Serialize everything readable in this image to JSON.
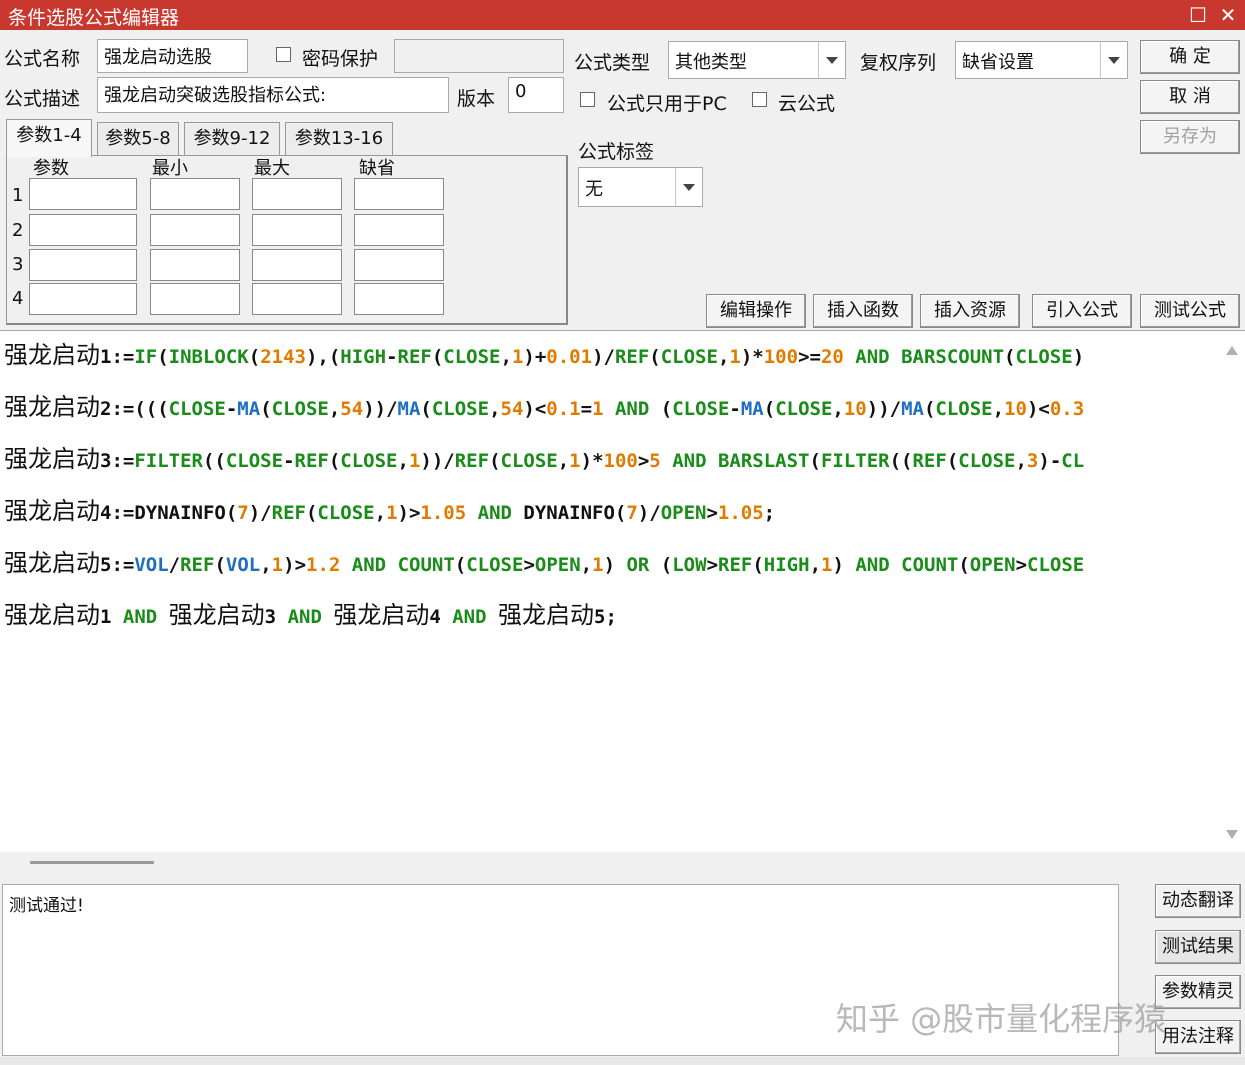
{
  "window": {
    "title": "条件选股公式编辑器"
  },
  "form": {
    "name_label": "公式名称",
    "name_value": "强龙启动选股",
    "password_label": "密码保护",
    "password_value": "",
    "desc_label": "公式描述",
    "desc_value": "强龙启动突破选股指标公式:",
    "version_label": "版本",
    "version_value": "0",
    "type_label": "公式类型",
    "type_value": "其他类型",
    "rights_label": "复权序列",
    "rights_value": "缺省设置",
    "pc_only_label": "公式只用于PC",
    "cloud_label": "云公式",
    "tag_label": "公式标签",
    "tag_value": "无"
  },
  "buttons": {
    "ok": "确  定",
    "cancel": "取  消",
    "save_as": "另存为",
    "edit_ops": "编辑操作",
    "insert_func": "插入函数",
    "insert_res": "插入资源",
    "import_formula": "引入公式",
    "test_formula": "测试公式"
  },
  "params": {
    "tabs": [
      "参数1-4",
      "参数5-8",
      "参数9-12",
      "参数13-16"
    ],
    "headers": [
      "参数",
      "最小",
      "最大",
      "缺省"
    ],
    "rows": [
      "1",
      "2",
      "3",
      "4"
    ]
  },
  "code_lines": [
    [
      [
        "cn",
        "强龙启动"
      ],
      [
        "b",
        "1:="
      ],
      [
        "g",
        "IF"
      ],
      [
        "b",
        "("
      ],
      [
        "g",
        "INBLOCK"
      ],
      [
        "b",
        "("
      ],
      [
        "o",
        "2143"
      ],
      [
        "b",
        "),("
      ],
      [
        "g",
        "HIGH"
      ],
      [
        "b",
        "-"
      ],
      [
        "g",
        "REF"
      ],
      [
        "b",
        "("
      ],
      [
        "g",
        "CLOSE"
      ],
      [
        "b",
        ","
      ],
      [
        "o",
        "1"
      ],
      [
        "b",
        ")+"
      ],
      [
        "o",
        "0.01"
      ],
      [
        "b",
        ")/"
      ],
      [
        "g",
        "REF"
      ],
      [
        "b",
        "("
      ],
      [
        "g",
        "CLOSE"
      ],
      [
        "b",
        ","
      ],
      [
        "o",
        "1"
      ],
      [
        "b",
        ")*"
      ],
      [
        "o",
        "100"
      ],
      [
        "b",
        ">="
      ],
      [
        "o",
        "20"
      ],
      [
        "b",
        " "
      ],
      [
        "g",
        "AND"
      ],
      [
        "b",
        " "
      ],
      [
        "g",
        "BARSCOUNT"
      ],
      [
        "b",
        "("
      ],
      [
        "g",
        "CLOSE"
      ],
      [
        "b",
        ")"
      ]
    ],
    [
      [
        "cn",
        "强龙启动"
      ],
      [
        "b",
        "2:=((("
      ],
      [
        "g",
        "CLOSE"
      ],
      [
        "b",
        "-"
      ],
      [
        "c",
        "MA"
      ],
      [
        "b",
        "("
      ],
      [
        "g",
        "CLOSE"
      ],
      [
        "b",
        ","
      ],
      [
        "o",
        "54"
      ],
      [
        "b",
        "))/"
      ],
      [
        "c",
        "MA"
      ],
      [
        "b",
        "("
      ],
      [
        "g",
        "CLOSE"
      ],
      [
        "b",
        ","
      ],
      [
        "o",
        "54"
      ],
      [
        "b",
        ")<"
      ],
      [
        "o",
        "0.1"
      ],
      [
        "b",
        "="
      ],
      [
        "o",
        "1"
      ],
      [
        "b",
        " "
      ],
      [
        "g",
        "AND"
      ],
      [
        "b",
        " ("
      ],
      [
        "g",
        "CLOSE"
      ],
      [
        "b",
        "-"
      ],
      [
        "c",
        "MA"
      ],
      [
        "b",
        "("
      ],
      [
        "g",
        "CLOSE"
      ],
      [
        "b",
        ","
      ],
      [
        "o",
        "10"
      ],
      [
        "b",
        "))/"
      ],
      [
        "c",
        "MA"
      ],
      [
        "b",
        "("
      ],
      [
        "g",
        "CLOSE"
      ],
      [
        "b",
        ","
      ],
      [
        "o",
        "10"
      ],
      [
        "b",
        ")<"
      ],
      [
        "o",
        "0.3"
      ]
    ],
    [
      [
        "cn",
        "强龙启动"
      ],
      [
        "b",
        "3:="
      ],
      [
        "g",
        "FILTER"
      ],
      [
        "b",
        "(("
      ],
      [
        "g",
        "CLOSE"
      ],
      [
        "b",
        "-"
      ],
      [
        "g",
        "REF"
      ],
      [
        "b",
        "("
      ],
      [
        "g",
        "CLOSE"
      ],
      [
        "b",
        ","
      ],
      [
        "o",
        "1"
      ],
      [
        "b",
        "))/"
      ],
      [
        "g",
        "REF"
      ],
      [
        "b",
        "("
      ],
      [
        "g",
        "CLOSE"
      ],
      [
        "b",
        ","
      ],
      [
        "o",
        "1"
      ],
      [
        "b",
        ")*"
      ],
      [
        "o",
        "100"
      ],
      [
        "b",
        ">"
      ],
      [
        "o",
        "5"
      ],
      [
        "b",
        " "
      ],
      [
        "g",
        "AND"
      ],
      [
        "b",
        " "
      ],
      [
        "g",
        "BARSLAST"
      ],
      [
        "b",
        "("
      ],
      [
        "g",
        "FILTER"
      ],
      [
        "b",
        "(("
      ],
      [
        "g",
        "REF"
      ],
      [
        "b",
        "("
      ],
      [
        "g",
        "CLOSE"
      ],
      [
        "b",
        ","
      ],
      [
        "o",
        "3"
      ],
      [
        "b",
        ")-"
      ],
      [
        "g",
        "CL"
      ]
    ],
    [
      [
        "cn",
        "强龙启动"
      ],
      [
        "b",
        "4:=DYNAINFO("
      ],
      [
        "o",
        "7"
      ],
      [
        "b",
        ")/"
      ],
      [
        "g",
        "REF"
      ],
      [
        "b",
        "("
      ],
      [
        "g",
        "CLOSE"
      ],
      [
        "b",
        ","
      ],
      [
        "o",
        "1"
      ],
      [
        "b",
        ")>"
      ],
      [
        "o",
        "1.05"
      ],
      [
        "b",
        " "
      ],
      [
        "g",
        "AND"
      ],
      [
        "b",
        " DYNAINFO("
      ],
      [
        "o",
        "7"
      ],
      [
        "b",
        ")/"
      ],
      [
        "g",
        "OPEN"
      ],
      [
        "b",
        ">"
      ],
      [
        "o",
        "1.05"
      ],
      [
        "b",
        ";"
      ]
    ],
    [
      [
        "cn",
        "强龙启动"
      ],
      [
        "b",
        "5:="
      ],
      [
        "c",
        "VOL"
      ],
      [
        "b",
        "/"
      ],
      [
        "g",
        "REF"
      ],
      [
        "b",
        "("
      ],
      [
        "c",
        "VOL"
      ],
      [
        "b",
        ","
      ],
      [
        "o",
        "1"
      ],
      [
        "b",
        ")>"
      ],
      [
        "o",
        "1.2"
      ],
      [
        "b",
        " "
      ],
      [
        "g",
        "AND"
      ],
      [
        "b",
        " "
      ],
      [
        "g",
        "COUNT"
      ],
      [
        "b",
        "("
      ],
      [
        "g",
        "CLOSE"
      ],
      [
        "b",
        ">"
      ],
      [
        "g",
        "OPEN"
      ],
      [
        "b",
        ","
      ],
      [
        "o",
        "1"
      ],
      [
        "b",
        ") "
      ],
      [
        "g",
        "OR"
      ],
      [
        "b",
        " ("
      ],
      [
        "g",
        "LOW"
      ],
      [
        "b",
        ">"
      ],
      [
        "g",
        "REF"
      ],
      [
        "b",
        "("
      ],
      [
        "g",
        "HIGH"
      ],
      [
        "b",
        ","
      ],
      [
        "o",
        "1"
      ],
      [
        "b",
        ") "
      ],
      [
        "g",
        "AND"
      ],
      [
        "b",
        " "
      ],
      [
        "g",
        "COUNT"
      ],
      [
        "b",
        "("
      ],
      [
        "g",
        "OPEN"
      ],
      [
        "b",
        ">"
      ],
      [
        "g",
        "CLOSE"
      ]
    ],
    [
      [
        "cn",
        "强龙启动"
      ],
      [
        "b",
        "1 "
      ],
      [
        "g",
        "AND"
      ],
      [
        "b",
        " "
      ],
      [
        "cn",
        "强龙启动"
      ],
      [
        "b",
        "3 "
      ],
      [
        "g",
        "AND"
      ],
      [
        "b",
        " "
      ],
      [
        "cn",
        "强龙启动"
      ],
      [
        "b",
        "4 "
      ],
      [
        "g",
        "AND"
      ],
      [
        "b",
        " "
      ],
      [
        "cn",
        "强龙启动"
      ],
      [
        "b",
        "5;"
      ]
    ]
  ],
  "result": {
    "text": "测试通过!"
  },
  "side_buttons": {
    "dynamic_translate": "动态翻译",
    "test_result": "测试结果",
    "param_wizard": "参数精灵",
    "usage_notes": "用法注释"
  },
  "watermark": "知乎 @股市量化程序猿",
  "colors": {
    "title_bar": "#c8382e",
    "keyword_green": "#1a8c1a",
    "number_orange": "#e07b00",
    "func_blue": "#1f6fc0"
  }
}
